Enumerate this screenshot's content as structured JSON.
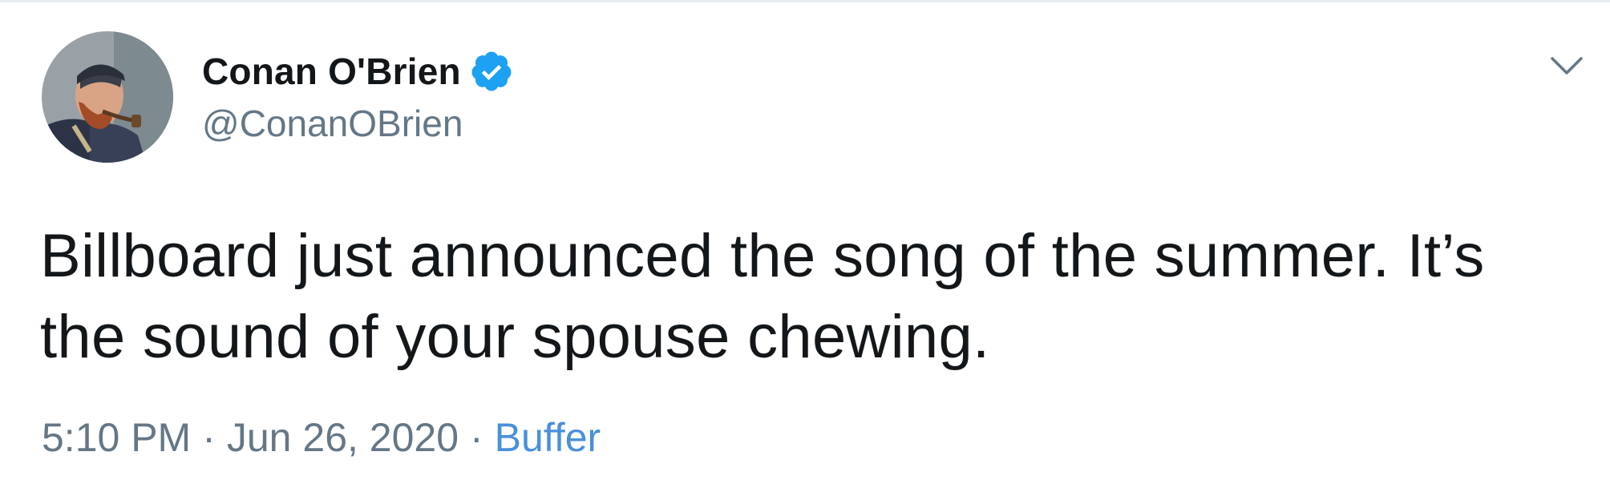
{
  "tweet": {
    "author": {
      "display_name": "Conan O'Brien",
      "handle": "@ConanOBrien",
      "verified": true
    },
    "text": "Billboard just announced the song of the summer. It’s the sound of your spouse chewing.",
    "time": "5:10 PM",
    "date": "Jun 26, 2020",
    "separator": "·",
    "source": "Buffer"
  },
  "icons": {
    "verified": "verified-badge-icon",
    "caret": "chevron-down-icon"
  },
  "colors": {
    "verified_blue": "#1da1f2",
    "secondary_text": "#657786",
    "link": "#4a90d9"
  }
}
